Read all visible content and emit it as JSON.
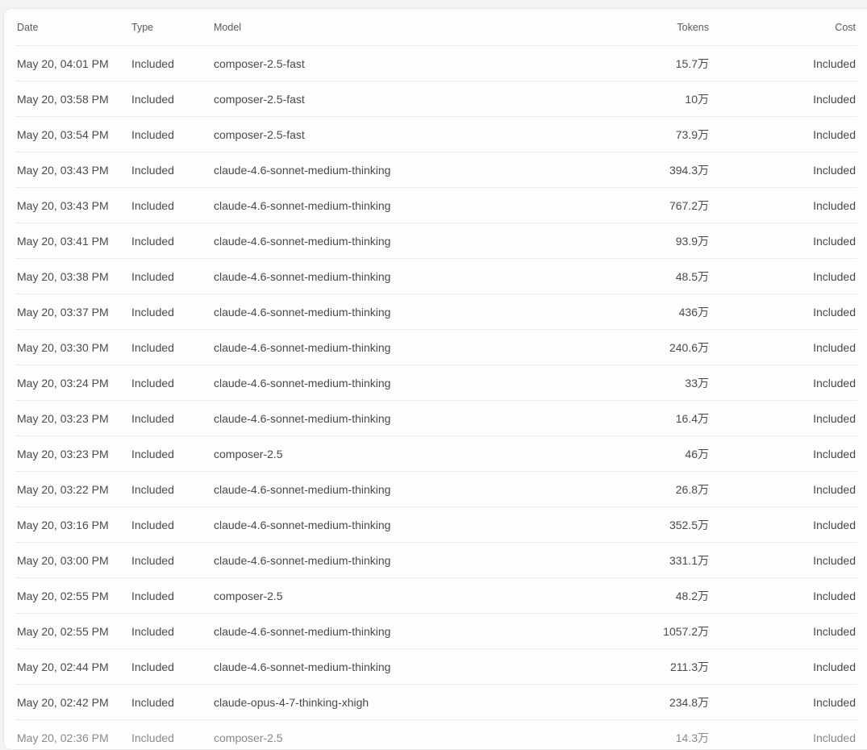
{
  "usage_table": {
    "columns": {
      "date": "Date",
      "type": "Type",
      "model": "Model",
      "tokens": "Tokens",
      "cost": "Cost"
    },
    "rows": [
      {
        "date": "May 20, 04:01 PM",
        "type": "Included",
        "model": "composer-2.5-fast",
        "tokens": "15.7万",
        "cost": "Included"
      },
      {
        "date": "May 20, 03:58 PM",
        "type": "Included",
        "model": "composer-2.5-fast",
        "tokens": "10万",
        "cost": "Included"
      },
      {
        "date": "May 20, 03:54 PM",
        "type": "Included",
        "model": "composer-2.5-fast",
        "tokens": "73.9万",
        "cost": "Included"
      },
      {
        "date": "May 20, 03:43 PM",
        "type": "Included",
        "model": "claude-4.6-sonnet-medium-thinking",
        "tokens": "394.3万",
        "cost": "Included"
      },
      {
        "date": "May 20, 03:43 PM",
        "type": "Included",
        "model": "claude-4.6-sonnet-medium-thinking",
        "tokens": "767.2万",
        "cost": "Included"
      },
      {
        "date": "May 20, 03:41 PM",
        "type": "Included",
        "model": "claude-4.6-sonnet-medium-thinking",
        "tokens": "93.9万",
        "cost": "Included"
      },
      {
        "date": "May 20, 03:38 PM",
        "type": "Included",
        "model": "claude-4.6-sonnet-medium-thinking",
        "tokens": "48.5万",
        "cost": "Included"
      },
      {
        "date": "May 20, 03:37 PM",
        "type": "Included",
        "model": "claude-4.6-sonnet-medium-thinking",
        "tokens": "436万",
        "cost": "Included"
      },
      {
        "date": "May 20, 03:30 PM",
        "type": "Included",
        "model": "claude-4.6-sonnet-medium-thinking",
        "tokens": "240.6万",
        "cost": "Included"
      },
      {
        "date": "May 20, 03:24 PM",
        "type": "Included",
        "model": "claude-4.6-sonnet-medium-thinking",
        "tokens": "33万",
        "cost": "Included"
      },
      {
        "date": "May 20, 03:23 PM",
        "type": "Included",
        "model": "claude-4.6-sonnet-medium-thinking",
        "tokens": "16.4万",
        "cost": "Included"
      },
      {
        "date": "May 20, 03:23 PM",
        "type": "Included",
        "model": "composer-2.5",
        "tokens": "46万",
        "cost": "Included"
      },
      {
        "date": "May 20, 03:22 PM",
        "type": "Included",
        "model": "claude-4.6-sonnet-medium-thinking",
        "tokens": "26.8万",
        "cost": "Included"
      },
      {
        "date": "May 20, 03:16 PM",
        "type": "Included",
        "model": "claude-4.6-sonnet-medium-thinking",
        "tokens": "352.5万",
        "cost": "Included"
      },
      {
        "date": "May 20, 03:00 PM",
        "type": "Included",
        "model": "claude-4.6-sonnet-medium-thinking",
        "tokens": "331.1万",
        "cost": "Included"
      },
      {
        "date": "May 20, 02:55 PM",
        "type": "Included",
        "model": "composer-2.5",
        "tokens": "48.2万",
        "cost": "Included"
      },
      {
        "date": "May 20, 02:55 PM",
        "type": "Included",
        "model": "claude-4.6-sonnet-medium-thinking",
        "tokens": "1057.2万",
        "cost": "Included"
      },
      {
        "date": "May 20, 02:44 PM",
        "type": "Included",
        "model": "claude-4.6-sonnet-medium-thinking",
        "tokens": "211.3万",
        "cost": "Included"
      },
      {
        "date": "May 20, 02:42 PM",
        "type": "Included",
        "model": "claude-opus-4-7-thinking-xhigh",
        "tokens": "234.8万",
        "cost": "Included"
      },
      {
        "date": "May 20, 02:36 PM",
        "type": "Included",
        "model": "composer-2.5",
        "tokens": "14.3万",
        "cost": "Included"
      }
    ]
  }
}
